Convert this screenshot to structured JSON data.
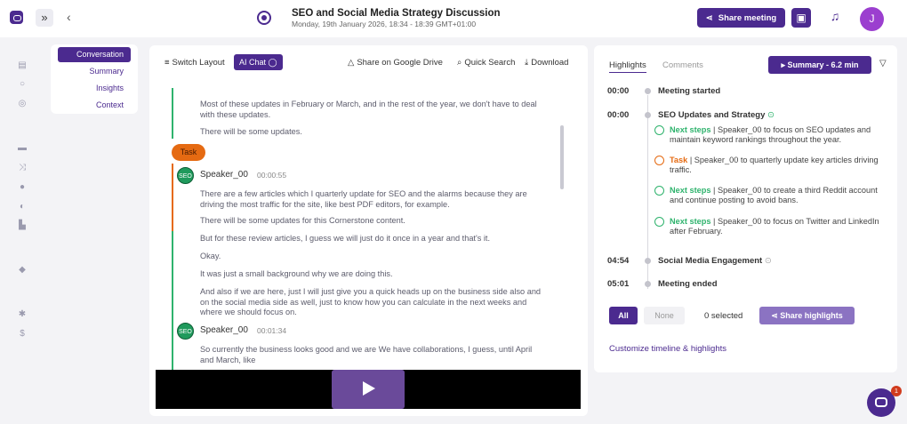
{
  "header": {
    "expand_icon": "»",
    "back_icon": "‹",
    "title": "SEO and Social Media Strategy Discussion",
    "date": "Monday, 19th January 2026, 18:34 - 18:39 GMT+01:00",
    "share_label": "Share meeting",
    "avatar_initial": "J"
  },
  "nav": {
    "items": [
      "Conversation",
      "Summary",
      "Insights",
      "Context"
    ]
  },
  "transcript_toolbar": {
    "switch_layout": "Switch Layout",
    "ai_chat": "AI Chat",
    "share_drive": "Share on Google Drive",
    "quick_search": "Quick Search",
    "download": "Download"
  },
  "transcript": {
    "para_1": "Most of these updates in February or March, and in the rest of the year, we don't have to deal with these updates.",
    "para_2": "There will be some updates.",
    "task_label": "Task",
    "speaker_1": {
      "avatar": "SEO",
      "name": "Speaker_00",
      "time": "00:00:55"
    },
    "para_3": "There are a few articles which I quarterly update for SEO and the alarms because they are driving the most traffic for the site, like best PDF editors, for example.",
    "para_4": "There will be some updates for this Cornerstone content.",
    "para_5": "But for these review articles, I guess we will just do it once in a year and that's it.",
    "para_6": "Okay.",
    "para_7": "It was just a small background why we are doing this.",
    "para_8": "And also if we are here, just I will just give you a quick heads up on the business side also and on the social media side as well, just to know how you can calculate in the next weeks and where we should focus on.",
    "speaker_2": {
      "avatar": "SEO",
      "name": "Speaker_00",
      "time": "00:01:34"
    },
    "para_9": "So currently the business looks good and we are We have collaborations, I guess, until April and March, like"
  },
  "highlights": {
    "tab_highlights": "Highlights",
    "tab_comments": "Comments",
    "summary_button": "▸ Summary - 6.2 min",
    "timeline": [
      {
        "time": "00:00",
        "label": "Meeting started"
      },
      {
        "time": "00:00",
        "label": "SEO Updates and Strategy"
      },
      {
        "time": "04:54",
        "label": "Social Media Engagement"
      },
      {
        "time": "05:01",
        "label": "Meeting ended"
      }
    ],
    "items": [
      {
        "kind": "Next steps",
        "text": " | Speaker_00 to focus on SEO updates and maintain keyword rankings throughout the year."
      },
      {
        "kind": "Task",
        "text": " | Speaker_00 to quarterly update key articles driving traffic."
      },
      {
        "kind": "Next steps",
        "text": " | Speaker_00 to create a third Reddit account and continue posting to avoid bans."
      },
      {
        "kind": "Next steps",
        "text": " | Speaker_00 to focus on Twitter and LinkedIn after February."
      }
    ],
    "filter_all": "All",
    "filter_none": "None",
    "selected_count": "0 selected",
    "share_highlights": "Share highlights",
    "customize": "Customize timeline & highlights"
  },
  "chat_badge": "1",
  "colors": {
    "accent": "#4b2a8f",
    "next_steps": "#2fb36d",
    "task": "#e56a12"
  }
}
